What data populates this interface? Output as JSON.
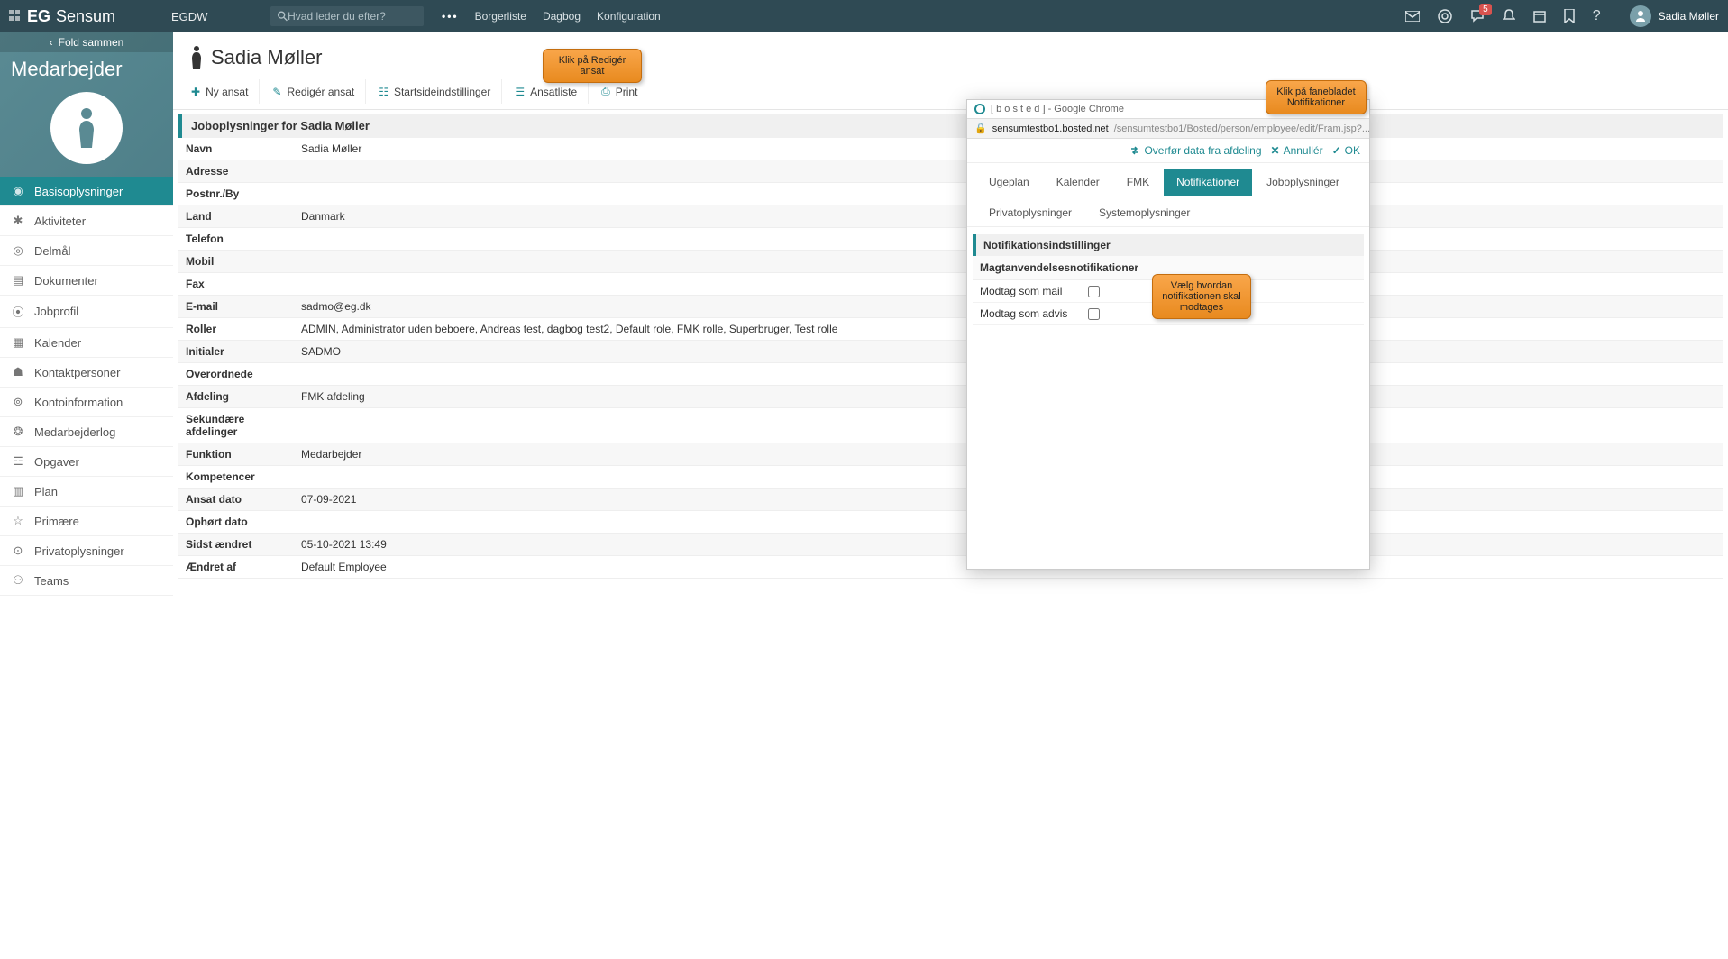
{
  "header": {
    "logo_brand": "EG",
    "logo_product": "Sensum",
    "org": "EGDW",
    "search_placeholder": "Hvad leder du efter?",
    "nav": [
      "Borgerliste",
      "Dagbog",
      "Konfiguration"
    ],
    "notification_badge": "5",
    "user_name": "Sadia Møller"
  },
  "sidebar": {
    "fold_label": "Fold sammen",
    "title": "Medarbejder",
    "items": [
      {
        "icon": "user",
        "label": "Basisoplysninger",
        "active": true
      },
      {
        "icon": "activity",
        "label": "Aktiviteter"
      },
      {
        "icon": "target",
        "label": "Delmål"
      },
      {
        "icon": "doc",
        "label": "Dokumenter"
      },
      {
        "icon": "profile",
        "label": "Jobprofil"
      },
      {
        "icon": "calendar",
        "label": "Kalender"
      },
      {
        "icon": "contacts",
        "label": "Kontaktpersoner"
      },
      {
        "icon": "account",
        "label": "Kontoinformation"
      },
      {
        "icon": "log",
        "label": "Medarbejderlog"
      },
      {
        "icon": "tasks",
        "label": "Opgaver"
      },
      {
        "icon": "plan",
        "label": "Plan"
      },
      {
        "icon": "star",
        "label": "Primære"
      },
      {
        "icon": "private",
        "label": "Privatoplysninger"
      },
      {
        "icon": "teams",
        "label": "Teams"
      }
    ]
  },
  "main": {
    "page_title": "Sadia Møller",
    "toolbar": [
      {
        "icon": "plus",
        "label": "Ny ansat"
      },
      {
        "icon": "edit",
        "label": "Redigér ansat"
      },
      {
        "icon": "settings",
        "label": "Startsideindstillinger"
      },
      {
        "icon": "list",
        "label": "Ansatliste"
      },
      {
        "icon": "print",
        "label": "Print"
      }
    ],
    "section_title_prefix": "Joboplysninger for ",
    "section_title_name": "Sadia Møller",
    "info": [
      {
        "label": "Navn",
        "value": "Sadia Møller"
      },
      {
        "label": "Adresse",
        "value": ""
      },
      {
        "label": "Postnr./By",
        "value": ""
      },
      {
        "label": "Land",
        "value": "Danmark"
      },
      {
        "label": "Telefon",
        "value": ""
      },
      {
        "label": "Mobil",
        "value": ""
      },
      {
        "label": "Fax",
        "value": ""
      },
      {
        "label": "E-mail",
        "value": "sadmo@eg.dk"
      },
      {
        "label": "Roller",
        "value": "ADMIN, Administrator uden beboere, Andreas test, dagbog test2, Default role, FMK rolle, Superbruger, Test rolle"
      },
      {
        "label": "Initialer",
        "value": "SADMO"
      },
      {
        "label": "Overordnede",
        "value": ""
      },
      {
        "label": "Afdeling",
        "value": "FMK afdeling"
      },
      {
        "label": "Sekundære afdelinger",
        "value": ""
      },
      {
        "label": "Funktion",
        "value": "Medarbejder"
      },
      {
        "label": "Kompetencer",
        "value": ""
      },
      {
        "label": "Ansat dato",
        "value": "07-09-2021"
      },
      {
        "label": "Ophørt dato",
        "value": ""
      },
      {
        "label": "Sidst ændret",
        "value": "05-10-2021 13:49"
      },
      {
        "label": "Ændret af",
        "value": "Default Employee"
      }
    ]
  },
  "popup": {
    "window_title": "[ b o s t e d ] - Google Chrome",
    "url_host": "sensumtestbo1.bosted.net",
    "url_path": "/sensumtestbo1/Bosted/person/employee/edit/Fram.jsp?...",
    "actions": {
      "transfer": "Overfør data fra afdeling",
      "cancel": "Annullér",
      "ok": "OK"
    },
    "tabs_row1": [
      "Ugeplan",
      "Kalender",
      "FMK",
      "Notifikationer"
    ],
    "tabs_row2": [
      "Joboplysninger",
      "Privatoplysninger",
      "Systemoplysninger"
    ],
    "active_tab": "Notifikationer",
    "section_title": "Notifikationsindstillinger",
    "subsection": "Magtanvendelsesnotifikationer",
    "rows": [
      {
        "label": "Modtag som mail",
        "checked": false
      },
      {
        "label": "Modtag som advis",
        "checked": false
      }
    ]
  },
  "callouts": {
    "edit": "Klik på Redigér ansat",
    "tab": "Klik på fanebladet Notifikationer",
    "choose": "Vælg hvordan notifikationen skal modtages"
  }
}
